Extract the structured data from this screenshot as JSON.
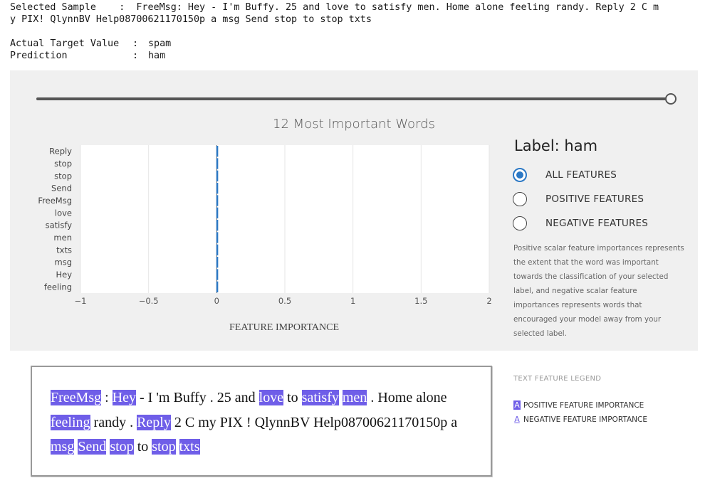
{
  "output": {
    "sample_label": "Selected Sample",
    "sample_line1": "FreeMsg: Hey - I'm Buffy. 25 and love to satisfy men. Home alone feeling randy. Reply 2 C m",
    "sample_line2": "y PIX! QlynnBV Help08700621170150p a msg Send stop to stop txts",
    "actual_label": "Actual Target Value",
    "actual_value": "spam",
    "prediction_label": "Prediction",
    "prediction_value": "ham",
    "colon": ":"
  },
  "slider": {
    "value": 1.0
  },
  "chart_data": {
    "type": "bar",
    "orientation": "horizontal",
    "title": "12 Most Important Words",
    "xlabel": "FEATURE IMPORTANCE",
    "ylabel": "",
    "categories": [
      "Reply",
      "stop",
      "stop",
      "Send",
      "FreeMsg",
      "love",
      "satisfy",
      "men",
      "txts",
      "msg",
      "Hey",
      "feeling"
    ],
    "values": [
      0.01,
      0.01,
      0.01,
      0.008,
      0.008,
      0.007,
      0.007,
      0.007,
      0.006,
      0.006,
      0.006,
      0.006
    ],
    "xlim": [
      -1,
      2
    ],
    "xticks": [
      -1,
      -0.5,
      0,
      0.5,
      1,
      1.5,
      2
    ],
    "xtick_labels": [
      "−1",
      "−0.5",
      "0",
      "0.5",
      "1",
      "1.5",
      "2"
    ],
    "grid": true,
    "bar_color": "#2b78c5"
  },
  "label_panel": {
    "title": "Label: ham",
    "options": [
      {
        "label": "ALL FEATURES",
        "checked": true
      },
      {
        "label": "POSITIVE FEATURES",
        "checked": false
      },
      {
        "label": "NEGATIVE FEATURES",
        "checked": false
      }
    ],
    "description": "Positive scalar feature importances represents the extent that the word was important towards the classification of your selected label, and negative scalar feature importances represents words that encouraged your model away from your selected label."
  },
  "text_view": {
    "tokens": [
      {
        "t": "FreeMsg",
        "h": "pos"
      },
      {
        "t": " : "
      },
      {
        "t": "Hey",
        "h": "pos"
      },
      {
        "t": " - I 'm Buffy . 25 and "
      },
      {
        "t": "love",
        "h": "pos"
      },
      {
        "t": " to "
      },
      {
        "t": "satisfy",
        "h": "pos"
      },
      {
        "t": " "
      },
      {
        "t": "men",
        "h": "pos"
      },
      {
        "t": " . Home alone "
      },
      {
        "t": "feeling",
        "h": "pos"
      },
      {
        "t": " randy . "
      },
      {
        "t": "Reply",
        "h": "pos"
      },
      {
        "t": " 2 C my PIX ! QlynnBV Help08700621170150p a "
      },
      {
        "t": "msg",
        "h": "pos"
      },
      {
        "t": " "
      },
      {
        "t": "Send",
        "h": "pos"
      },
      {
        "t": " "
      },
      {
        "t": "stop",
        "h": "pos"
      },
      {
        "t": " to "
      },
      {
        "t": "stop",
        "h": "pos"
      },
      {
        "t": " "
      },
      {
        "t": "txts",
        "h": "pos"
      }
    ]
  },
  "legend": {
    "title": "TEXT FEATURE LEGEND",
    "swatch_letter": "A",
    "positive_label": "POSITIVE FEATURE IMPORTANCE",
    "negative_label": "NEGATIVE FEATURE IMPORTANCE",
    "highlight_color": "#6f5ee8"
  }
}
